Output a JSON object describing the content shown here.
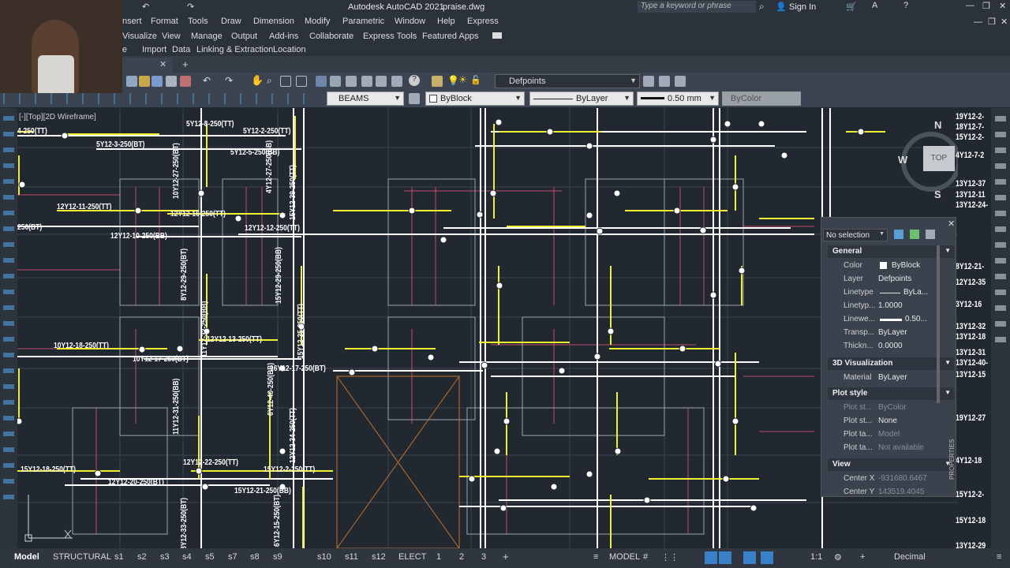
{
  "app": {
    "title": "Autodesk AutoCAD 2021",
    "filename": "praise.dwg",
    "search_placeholder": "Type a keyword or phrase",
    "sign_in": "Sign In"
  },
  "menubar": [
    "Insert",
    "Format",
    "Tools",
    "Draw",
    "Dimension",
    "Modify",
    "Parametric",
    "Window",
    "Help",
    "Express"
  ],
  "ribbon_tabs": [
    "Visualize",
    "View",
    "Manage",
    "Output",
    "Add-ins",
    "Collaborate",
    "Express Tools",
    "Featured Apps"
  ],
  "ribbon_tabs2": [
    "Home",
    "Import",
    "Data",
    "Linking & Extraction",
    "Location"
  ],
  "toolbar": {
    "layer_name": "Defpoints",
    "beams_dropdown": "BEAMS",
    "color_dropdown": "ByBlock",
    "linetype_dropdown": "ByLayer",
    "lineweight_dropdown": "0.50 mm",
    "plotstyle_dropdown": "ByColor"
  },
  "viewport": {
    "label": "[-][Top][2D Wireframe]",
    "viewcube": {
      "north": "N",
      "west": "W",
      "east": "E",
      "south": "S",
      "top": "TOP"
    }
  },
  "properties": {
    "selection": "No selection",
    "sections": {
      "general": "General",
      "visualization": "3D Visualization",
      "plot": "Plot style",
      "view": "View"
    },
    "general_rows": [
      {
        "key": "Color",
        "value": "ByBlock"
      },
      {
        "key": "Layer",
        "value": "Defpoints"
      },
      {
        "key": "Linetype",
        "value": "ByLa..."
      },
      {
        "key": "Linetyp...",
        "value": "1.0000"
      },
      {
        "key": "Linewe...",
        "value": "0.50..."
      },
      {
        "key": "Transp...",
        "value": "ByLayer"
      },
      {
        "key": "Thickn...",
        "value": "0.0000"
      }
    ],
    "viz_rows": [
      {
        "key": "Material",
        "value": "ByLayer"
      }
    ],
    "plot_rows": [
      {
        "key": "Plot st...",
        "value": "ByColor"
      },
      {
        "key": "Plot st...",
        "value": "None"
      },
      {
        "key": "Plot ta...",
        "value": "Model"
      },
      {
        "key": "Plot ta...",
        "value": "Not available"
      }
    ],
    "view_rows": [
      {
        "key": "Center X",
        "value": "-931680.6467"
      },
      {
        "key": "Center Y",
        "value": "143519.4045"
      }
    ],
    "side_label": "PROPERTIES"
  },
  "drawing_labels": [
    "5Y12-8-250(TT)",
    "5Y12-2-250(TT)",
    "5Y12-3-250(BT)",
    "5Y12-5-250(BB)",
    "12Y12-11-250(TT)",
    "12Y12-10-250(BB)",
    "12Y12-12-250(TT)",
    "12Y12-16-250(TT)",
    "10Y12-18-250(TT)",
    "10Y12-17-250(BT)",
    "12Y12-13-250(TT)",
    "16Y12-17-250(BT)",
    "15Y12-18-250(TT)",
    "12Y12-20-250(BT)",
    "15Y12-21-250(BB)",
    "12Y12-22-250(TT)",
    "15Y12-2-250(TT)",
    "4-250(TT)",
    "250(BT)",
    "10Y12-27-250(BT)",
    "8Y12-29-250(BT)",
    "15Y12-29-250(BB)",
    "11Y12-31-250(BB)",
    "12Y12-34-250(TT)",
    "6Y12-40-250(BB)",
    "8Y12-33-250(BT)",
    "6Y12-15-250(BT)",
    "11Y12-32-250(BB)",
    "15Y12-35-250(TT)",
    "4Y12-27-250(BB)",
    "15Y12-39-250(TT)"
  ],
  "right_labels": [
    "19Y12-2-",
    "18Y12-7-",
    "15Y12-2-",
    "4Y12-7-2",
    "13Y12-37",
    "13Y12-11",
    "13Y12-24-",
    "8Y12-21-",
    "12Y12-35",
    "3Y12-16",
    "13Y12-32",
    "13Y12-18",
    "13Y12-31",
    "13Y12-40-",
    "13Y12-15",
    "19Y12-27",
    "4Y12-18",
    "15Y12-2-",
    "15Y12-18",
    "13Y12-29"
  ],
  "status": {
    "layout_tabs": [
      "Model",
      "STRUCTURAL",
      "s1",
      "s2",
      "s3",
      "s4",
      "s5",
      "s7",
      "s8",
      "s9",
      "s10",
      "s11",
      "s12",
      "ELECT",
      "1",
      "2",
      "3"
    ],
    "model_label": "MODEL",
    "scale": "1:1",
    "units": "Decimal"
  }
}
